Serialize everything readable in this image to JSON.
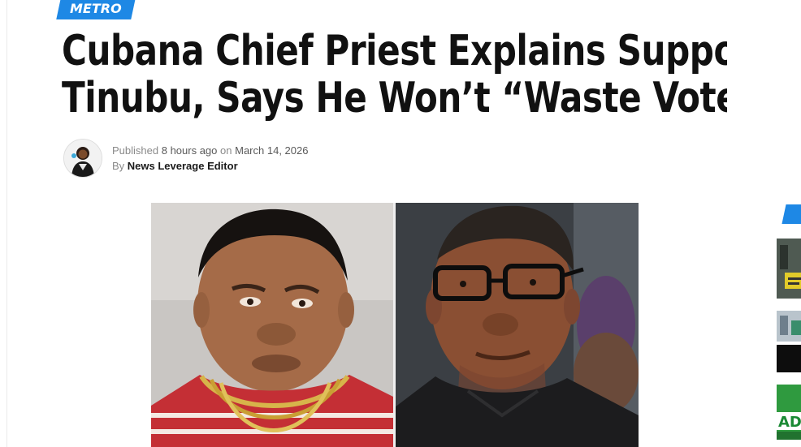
{
  "article": {
    "category": "METRO",
    "headline_line1": "Cubana Chief Priest Explains Support for",
    "headline_line2": "Tinubu, Says He Won’t “Waste Vote Again",
    "published_prefix": "Published",
    "published_relative": "8 hours ago",
    "published_on": "on",
    "published_date": "March 14, 2026",
    "by_prefix": "By",
    "author": "News Leverage Editor"
  },
  "colors": {
    "accent": "#1e88e5",
    "headline": "#111111",
    "meta_text": "#8a8a8a"
  },
  "icons": {
    "author_avatar": "avatar-icon"
  }
}
